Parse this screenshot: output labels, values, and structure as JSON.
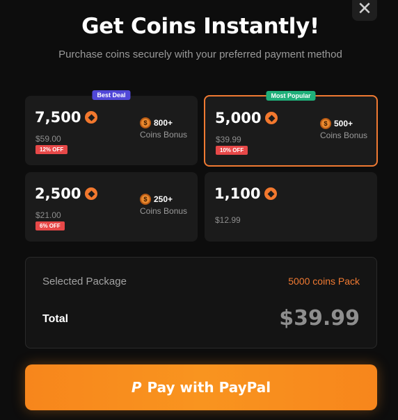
{
  "dialog": {
    "close_symbol": "✕",
    "title": "Get Coins Instantly!",
    "subtitle": "Purchase coins securely with your preferred payment method"
  },
  "packages": [
    {
      "badge": "Best Deal",
      "amount": "7,500",
      "price": "$59.00",
      "discount": "12% OFF",
      "bonus": "800+",
      "bonus_label": "Coins Bonus",
      "selected": false
    },
    {
      "badge": "Most Popular",
      "amount": "5,000",
      "price": "$39.99",
      "discount": "10% OFF",
      "bonus": "500+",
      "bonus_label": "Coins Bonus",
      "selected": true
    },
    {
      "badge": "",
      "amount": "2,500",
      "price": "$21.00",
      "discount": "6% OFF",
      "bonus": "250+",
      "bonus_label": "Coins Bonus",
      "selected": false
    },
    {
      "badge": "",
      "amount": "1,100",
      "price": "$12.99",
      "discount": "",
      "bonus": "",
      "bonus_label": "",
      "selected": false
    }
  ],
  "summary": {
    "selected_label": "Selected Package",
    "selected_value": "5000 coins Pack",
    "total_label": "Total",
    "total_value": "$39.99"
  },
  "pay_button": {
    "icon": "paypal-icon",
    "label": "Pay with PayPal"
  },
  "colors": {
    "accent": "#f07a32",
    "best_deal_badge": "#5148d8",
    "popular_badge": "#1fb07a",
    "discount": "#e74848",
    "pay_button": "#f7861c"
  }
}
